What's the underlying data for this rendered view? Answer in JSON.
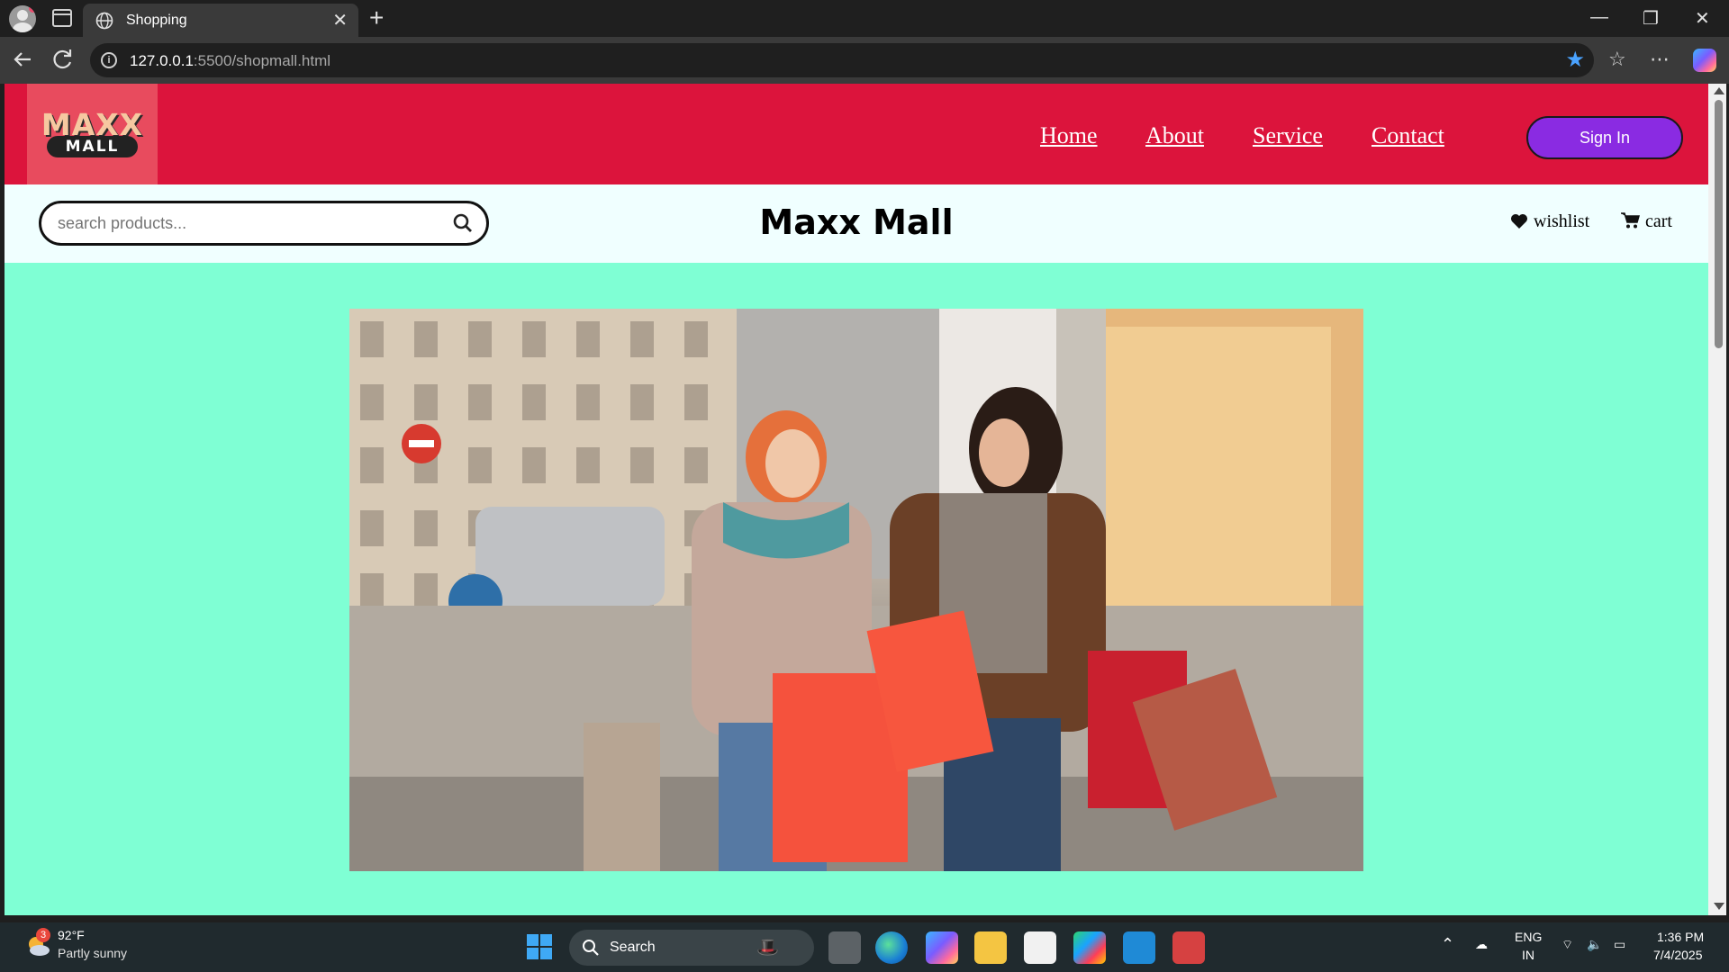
{
  "browser": {
    "tab_title": "Shopping",
    "url_host": "127.0.0.1",
    "url_rest": ":5500/shopmall.html"
  },
  "site": {
    "logo_top": "MAXX",
    "logo_bottom": "MALL",
    "nav": [
      "Home",
      "About",
      "Service",
      "Contact"
    ],
    "signin_label": "Sign In",
    "search_placeholder": "search products...",
    "brand_title": "Maxx Mall",
    "wishlist_label": "wishlist",
    "cart_label": "cart",
    "colors": {
      "header_bg": "#dc143c",
      "subbar_bg": "#f0ffff",
      "page_bg": "#7fffd4",
      "signin_bg": "#8a2be2"
    },
    "hero_image": "two women carrying shopping bags on a city street"
  },
  "taskbar": {
    "weather_badge": "3",
    "weather_temp": "92°F",
    "weather_condition": "Partly sunny",
    "search_label": "Search",
    "lang_top": "ENG",
    "lang_bottom": "IN",
    "time": "1:36 PM",
    "date": "7/4/2025"
  }
}
